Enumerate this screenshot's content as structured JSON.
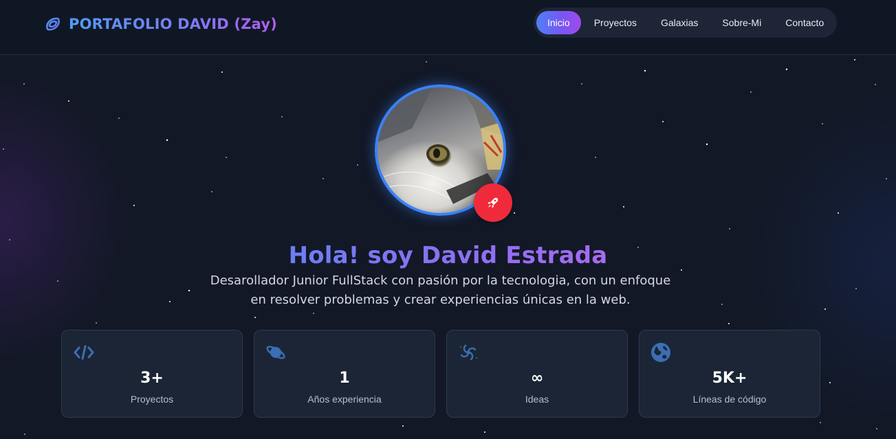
{
  "brand": {
    "title": "PORTAFOLIO DAVID (Zay)",
    "icon": "galaxy-logo-icon"
  },
  "nav": {
    "items": [
      {
        "label": "Inicio",
        "active": true
      },
      {
        "label": "Proyectos",
        "active": false
      },
      {
        "label": "Galaxias",
        "active": false
      },
      {
        "label": "Sobre-Mi",
        "active": false
      },
      {
        "label": "Contacto",
        "active": false
      }
    ]
  },
  "hero": {
    "avatar_icon": "profile-photo-cat",
    "badge_icon": "rocket-icon",
    "title": "Hola! soy David Estrada",
    "subtitle": "Desarollador Junior FullStack con pasión por la tecnologia, con un enfoque en resolver problemas y crear experiencias únicas en la web."
  },
  "stats": [
    {
      "icon": "code-icon",
      "value": "3+",
      "label": "Proyectos"
    },
    {
      "icon": "planet-icon",
      "value": "1",
      "label": "Años experiencia"
    },
    {
      "icon": "galaxy-icon",
      "value": "∞",
      "label": "Ideas"
    },
    {
      "icon": "globe-icon",
      "value": "5K+",
      "label": "Líneas de código"
    }
  ],
  "colors": {
    "background": "#121826",
    "accent_blue": "#3b82f6",
    "accent_purple": "#a14ae8",
    "badge_red": "#ef2b3b",
    "card_bg": "#1c2535",
    "icon_blue": "#3b6fb5"
  }
}
